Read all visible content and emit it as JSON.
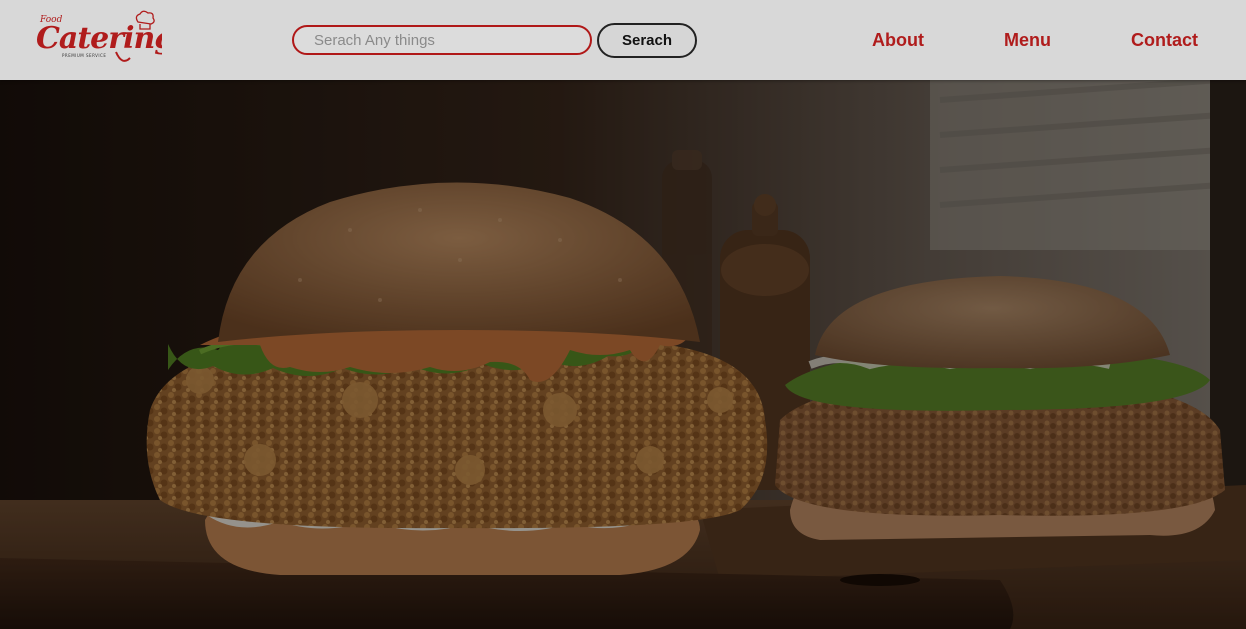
{
  "header": {
    "logo": {
      "small_text": "Food",
      "brand_text": "Catering",
      "tagline": "PREMIUM SERVICE",
      "icon": "chef-hat-icon"
    },
    "search": {
      "placeholder": "Serach Any things",
      "value": "",
      "button_label": "Serach"
    },
    "nav": {
      "about": "About",
      "menu": "Menu",
      "contact": "Contact"
    }
  },
  "hero": {
    "image": "fried-chicken-burger-photo",
    "overlay": "dark"
  },
  "colors": {
    "header_bg": "#d8d8d8",
    "accent_red": "#b01c1c",
    "overlay": "#000000"
  }
}
